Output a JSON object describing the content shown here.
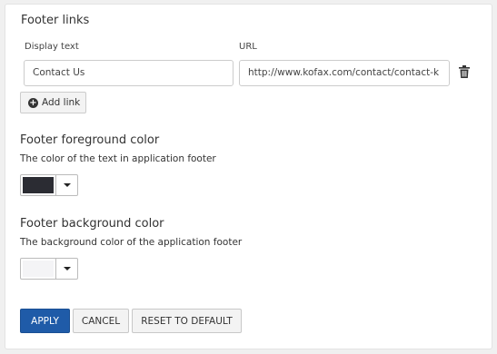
{
  "footer_links": {
    "title": "Footer links",
    "display_text_label": "Display text",
    "url_label": "URL",
    "rows": [
      {
        "display_text": "Contact Us",
        "url": "http://www.kofax.com/contact/contact-k"
      }
    ],
    "delete_icon": "trash-icon",
    "add_link_label": "Add link",
    "add_link_icon": "plus-circle-icon"
  },
  "foreground": {
    "title": "Footer foreground color",
    "description": "The color of the text in application footer",
    "color": "#2b2c33"
  },
  "background": {
    "title": "Footer background color",
    "description": "The background color of the application footer",
    "color": "#f4f4f6"
  },
  "actions": {
    "apply_label": "APPLY",
    "cancel_label": "CANCEL",
    "reset_label": "RESET TO DEFAULT",
    "primary_color": "#1f5ba8"
  }
}
